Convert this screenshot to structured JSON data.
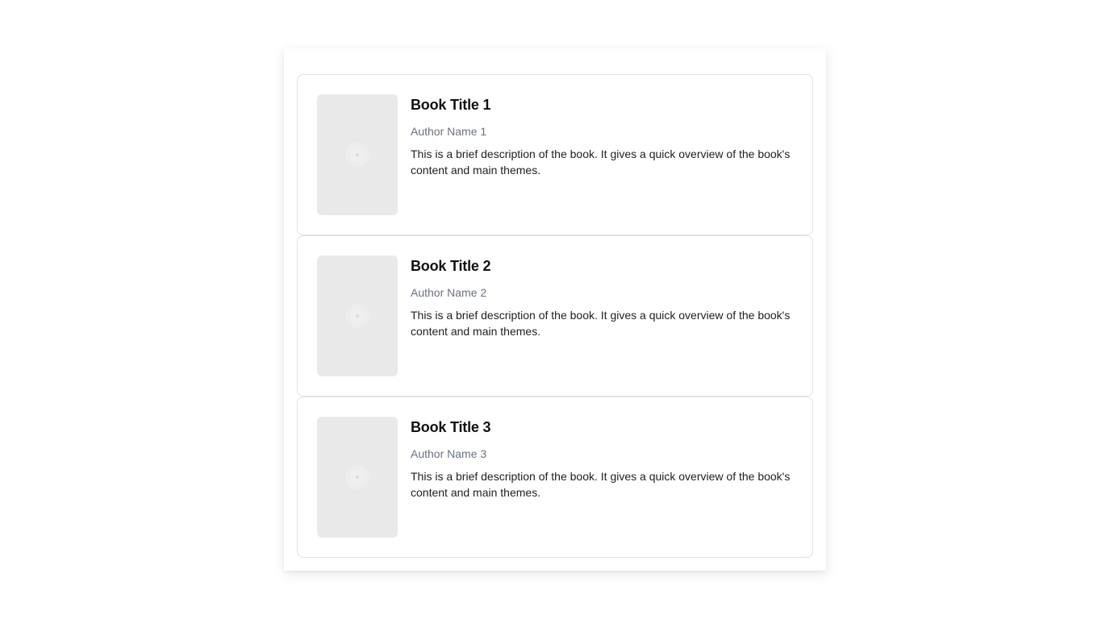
{
  "books": [
    {
      "title": "Book Title 1",
      "author": "Author Name 1",
      "description": "This is a brief description of the book. It gives a quick overview of the book's content and main themes.",
      "cover_icon": "image-placeholder-icon"
    },
    {
      "title": "Book Title 2",
      "author": "Author Name 2",
      "description": "This is a brief description of the book. It gives a quick overview of the book's content and main themes.",
      "cover_icon": "image-placeholder-icon"
    },
    {
      "title": "Book Title 3",
      "author": "Author Name 3",
      "description": "This is a brief description of the book. It gives a quick overview of the book's content and main themes.",
      "cover_icon": "image-placeholder-icon"
    }
  ],
  "colors": {
    "cover_placeholder": "#e9e9ea",
    "title": "#111111",
    "author": "#6b7280",
    "description": "#1f1f1f",
    "card_border": "#e2e2e4"
  }
}
